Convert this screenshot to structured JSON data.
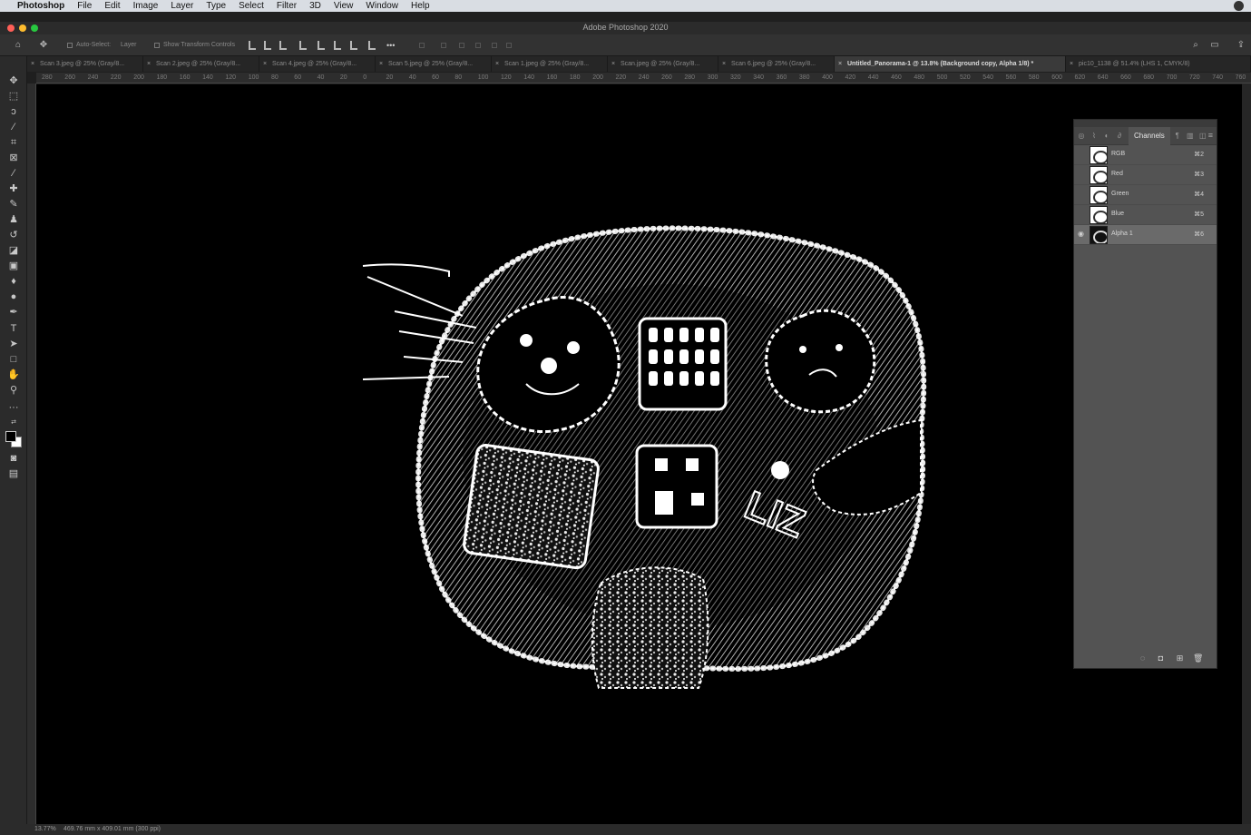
{
  "menubar": {
    "app": "Photoshop",
    "items": [
      "File",
      "Edit",
      "Image",
      "Layer",
      "Type",
      "Select",
      "Filter",
      "3D",
      "View",
      "Window",
      "Help"
    ]
  },
  "window": {
    "title": "Adobe Photoshop 2020"
  },
  "options": {
    "auto_select": "Auto-Select:",
    "layer_dropdown": "Layer",
    "show_transform": "Show Transform Controls",
    "more": "•••"
  },
  "tabs": [
    {
      "label": "Scan 3.jpeg @ 25% (Gray/8...",
      "active": false
    },
    {
      "label": "Scan 2.jpeg @ 25% (Gray/8...",
      "active": false
    },
    {
      "label": "Scan 4.jpeg @ 25% (Gray/8...",
      "active": false
    },
    {
      "label": "Scan 5.jpeg @ 25% (Gray/8...",
      "active": false
    },
    {
      "label": "Scan 1.jpeg @ 25% (Gray/8...",
      "active": false
    },
    {
      "label": "Scan.jpeg @ 25% (Gray/8...",
      "active": false
    },
    {
      "label": "Scan 6.jpeg @ 25% (Gray/8...",
      "active": false
    },
    {
      "label": "Untitled_Panorama-1 @ 13.8% (Background copy, Alpha 1/8) *",
      "active": true
    },
    {
      "label": "pic10_1138 @ 51.4% (LHS 1, CMYK/8)",
      "active": false
    }
  ],
  "ruler_ticks": [
    "280",
    "260",
    "240",
    "220",
    "200",
    "180",
    "160",
    "140",
    "120",
    "100",
    "80",
    "60",
    "40",
    "20",
    "0",
    "20",
    "40",
    "60",
    "80",
    "100",
    "120",
    "140",
    "160",
    "180",
    "200",
    "220",
    "240",
    "260",
    "280",
    "300",
    "320",
    "340",
    "360",
    "380",
    "400",
    "420",
    "440",
    "460",
    "480",
    "500",
    "520",
    "540",
    "560",
    "580",
    "600",
    "620",
    "640",
    "660",
    "680",
    "700",
    "720",
    "740",
    "760"
  ],
  "toolbar": {
    "tools": [
      "move-icon",
      "marquee-icon",
      "lasso-icon",
      "magic-wand-icon",
      "crop-icon",
      "frame-icon",
      "eyedropper-icon",
      "healing-brush-icon",
      "brush-icon",
      "clone-stamp-icon",
      "history-brush-icon",
      "eraser-icon",
      "gradient-icon",
      "blur-icon",
      "dodge-icon",
      "pen-icon",
      "type-icon",
      "path-selection-icon",
      "rectangle-icon",
      "hand-icon",
      "zoom-icon",
      "edit-toolbar-icon"
    ],
    "foreground": "#000000",
    "background": "#ffffff"
  },
  "canvas": {
    "text": "LIZ"
  },
  "channels_panel": {
    "title": "Channels",
    "channels": [
      {
        "name": "RGB",
        "shortcut": "⌘2",
        "visible": false,
        "selected": false
      },
      {
        "name": "Red",
        "shortcut": "⌘3",
        "visible": false,
        "selected": false
      },
      {
        "name": "Green",
        "shortcut": "⌘4",
        "visible": false,
        "selected": false
      },
      {
        "name": "Blue",
        "shortcut": "⌘5",
        "visible": false,
        "selected": false
      },
      {
        "name": "Alpha 1",
        "shortcut": "⌘6",
        "visible": true,
        "selected": true
      }
    ]
  },
  "status": {
    "zoom": "13.77%",
    "dimensions": "469.76 mm x 409.01 mm (300 ppi)"
  }
}
